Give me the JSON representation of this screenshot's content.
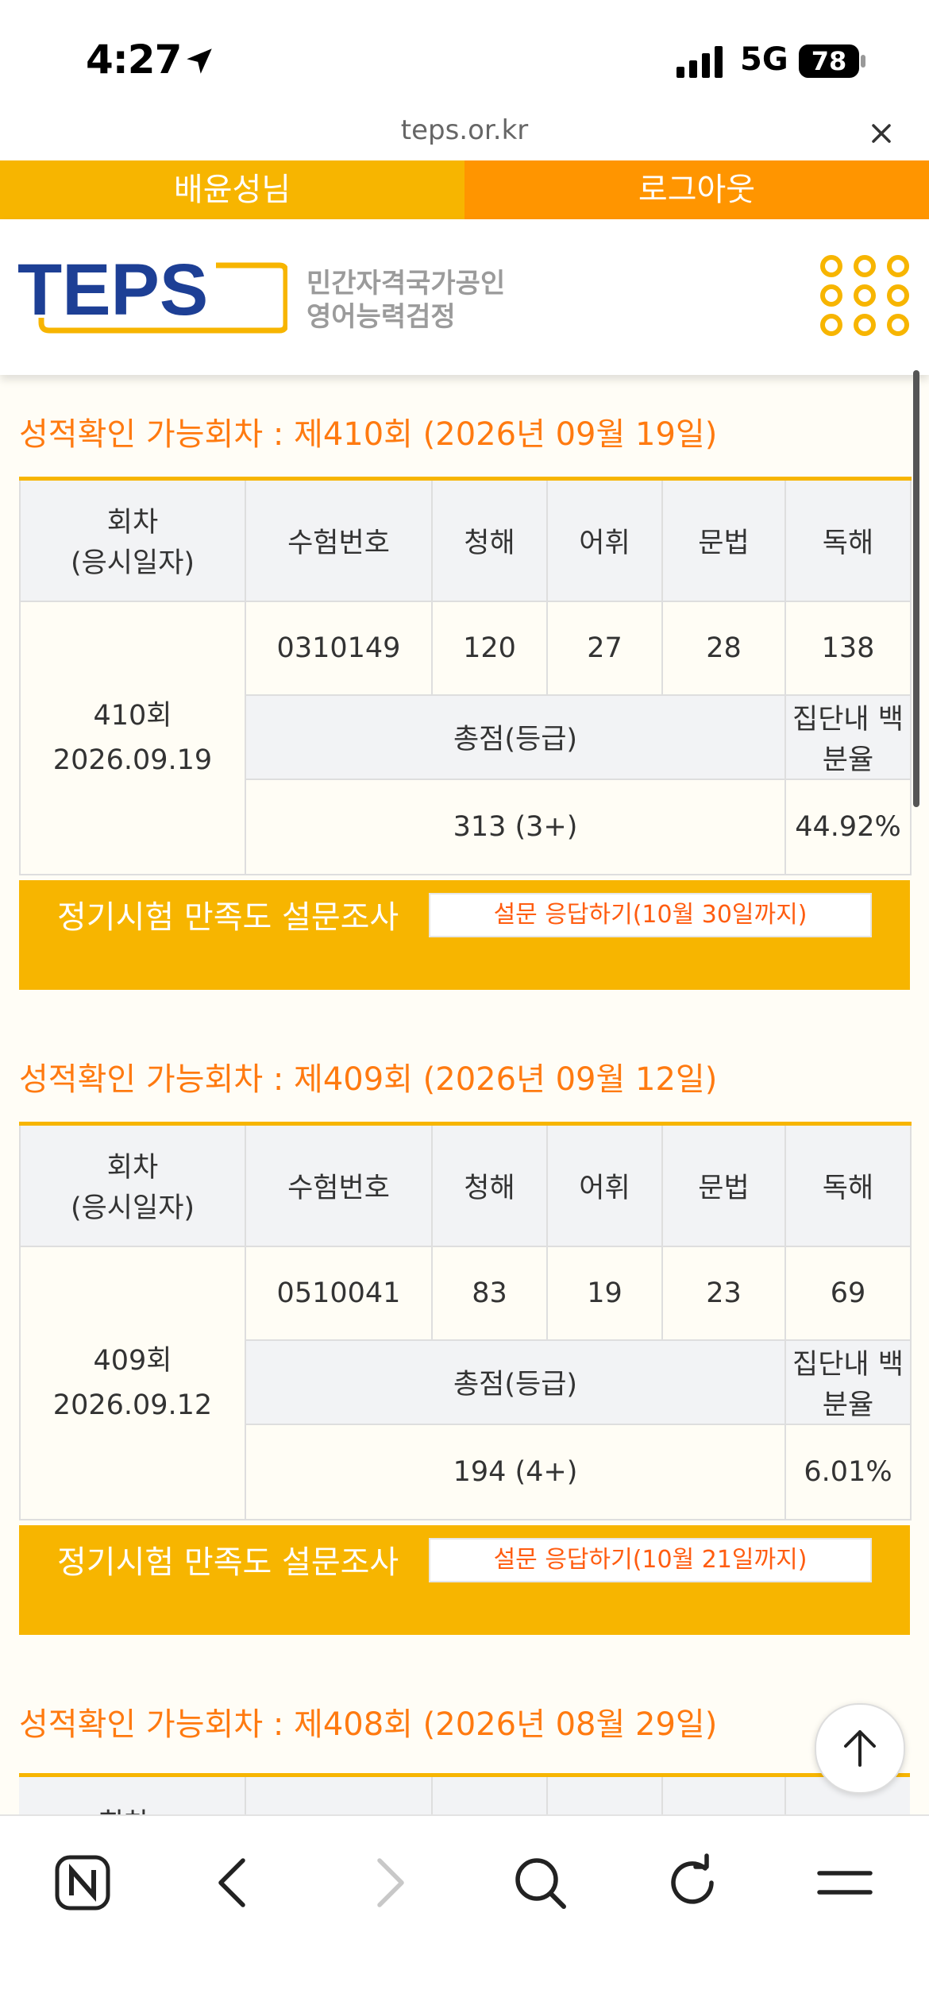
{
  "status_bar": {
    "time": "4:27",
    "network": "5G",
    "battery": "78"
  },
  "browser": {
    "url": "teps.or.kr"
  },
  "user_bar": {
    "user_name": "배윤성님",
    "logout_label": "로그아웃"
  },
  "header": {
    "logo_text": "TEPS",
    "logo_sub_line1": "민간자격국가공인",
    "logo_sub_line2": "영어능력검정"
  },
  "colors": {
    "accent_yellow": "#f7b500",
    "accent_orange": "#ff9500",
    "title_orange": "#ff7a10"
  },
  "table_headers": {
    "session": "회차",
    "session_sub": "(응시일자)",
    "exam_number": "수험번호",
    "listening": "청해",
    "vocabulary": "어휘",
    "grammar": "문법",
    "reading": "독해",
    "total": "총점(등급)",
    "percentile": "집단내 백분율"
  },
  "results": [
    {
      "title": "성적확인 가능회차 : 제410회 (2026년 09월 19일)",
      "session": "410회",
      "date": "2026.09.19",
      "exam_number": "0310149",
      "listening": "120",
      "vocabulary": "27",
      "grammar": "28",
      "reading": "138",
      "total": "313 (3+)",
      "percentile": "44.92%",
      "survey_label": "정기시험 만족도 설문조사",
      "survey_button": "설문 응답하기(10월 30일까지)"
    },
    {
      "title": "성적확인 가능회차 : 제409회 (2026년 09월 12일)",
      "session": "409회",
      "date": "2026.09.12",
      "exam_number": "0510041",
      "listening": "83",
      "vocabulary": "19",
      "grammar": "23",
      "reading": "69",
      "total": "194 (4+)",
      "percentile": "6.01%",
      "survey_label": "정기시험 만족도 설문조사",
      "survey_button": "설문 응답하기(10월 21일까지)"
    },
    {
      "title": "성적확인 가능회차 : 제408회 (2026년 08월 29일)"
    }
  ],
  "toolbar": {
    "icons": [
      "naver-icon",
      "back-icon",
      "forward-icon",
      "search-icon",
      "reload-icon",
      "menu-icon"
    ]
  }
}
